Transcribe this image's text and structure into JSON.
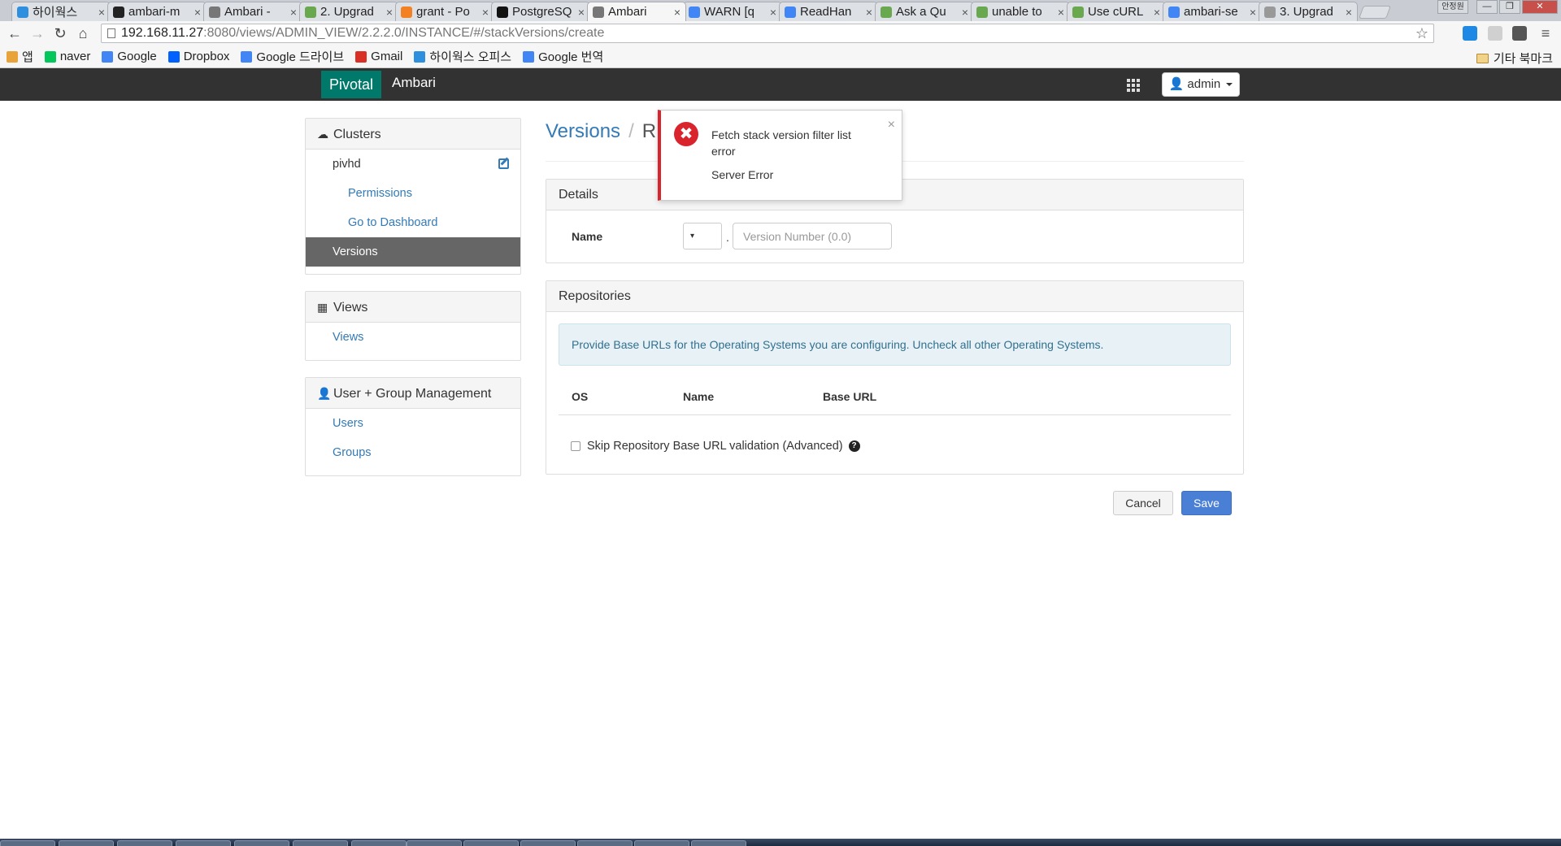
{
  "browser": {
    "tabs": [
      {
        "title": "하이웍스",
        "color": "#2f8fdf",
        "active": false
      },
      {
        "title": "ambari-m",
        "color": "#222222",
        "active": false
      },
      {
        "title": "Ambari -",
        "color": "#777777",
        "active": false
      },
      {
        "title": "2. Upgrad",
        "color": "#6aa84f",
        "active": false
      },
      {
        "title": "grant - Po",
        "color": "#f48024",
        "active": false
      },
      {
        "title": "PostgreSQ",
        "color": "#111111",
        "active": false
      },
      {
        "title": "Ambari",
        "color": "#777777",
        "active": true
      },
      {
        "title": "WARN [q",
        "color": "#4285f4",
        "active": false
      },
      {
        "title": "ReadHan",
        "color": "#4285f4",
        "active": false
      },
      {
        "title": "Ask a Qu",
        "color": "#6aa84f",
        "active": false
      },
      {
        "title": "unable to",
        "color": "#6aa84f",
        "active": false
      },
      {
        "title": "Use cURL",
        "color": "#6aa84f",
        "active": false
      },
      {
        "title": "ambari-se",
        "color": "#4285f4",
        "active": false
      },
      {
        "title": "3. Upgrad",
        "color": "#999999",
        "active": false
      }
    ],
    "window_user": "안정원",
    "url_host": "192.168.11.27",
    "url_rest": ":8080/views/ADMIN_VIEW/2.2.2.0/INSTANCE/#/stackVersions/create",
    "bookmarks": [
      {
        "label": "앱",
        "color": "#e8a33b",
        "icon": "apps-icon"
      },
      {
        "label": "naver",
        "color": "#03c75a",
        "icon": "naver-icon"
      },
      {
        "label": "Google",
        "color": "#4285f4",
        "icon": "google-icon"
      },
      {
        "label": "Dropbox",
        "color": "#0061fe",
        "icon": "dropbox-icon"
      },
      {
        "label": "Google 드라이브",
        "color": "#4285f4",
        "icon": "google-icon"
      },
      {
        "label": "Gmail",
        "color": "#d93025",
        "icon": "gmail-icon"
      },
      {
        "label": "하이웍스 오피스",
        "color": "#2f8fdf",
        "icon": "hiworks-icon"
      },
      {
        "label": "Google 번역",
        "color": "#4285f4",
        "icon": "translate-icon"
      }
    ],
    "other_bookmarks": "기타 북마크"
  },
  "app": {
    "brand_left": "Pivotal",
    "brand_right": "Ambari",
    "user_menu": "admin"
  },
  "sidebar": {
    "clusters_title": "Clusters",
    "cluster_name": "pivhd",
    "permissions": "Permissions",
    "go_to_dashboard": "Go to Dashboard",
    "versions": "Versions",
    "views_title": "Views",
    "views_link": "Views",
    "ugm_title": "User + Group Management",
    "users": "Users",
    "groups": "Groups"
  },
  "main": {
    "breadcrumb_root": "Versions",
    "breadcrumb_sep": "/",
    "breadcrumb_current": "R",
    "details_title": "Details",
    "name_label": "Name",
    "stack_select_value": "▾",
    "name_dot": ".",
    "version_placeholder": "Version Number (0.0)",
    "repos_title": "Repositories",
    "repos_info": "Provide Base URLs for the Operating Systems you are configuring. Uncheck all other Operating Systems.",
    "table_headers": [
      "OS",
      "Name",
      "Base URL"
    ],
    "skip_validation": "Skip Repository Base URL validation (Advanced)",
    "cancel": "Cancel",
    "save": "Save"
  },
  "toast": {
    "title": "Fetch stack version filter list error",
    "message": "Server Error",
    "close": "×"
  },
  "colors": {
    "navbar": "#323232",
    "pivotal_green": "#00796b",
    "link_blue": "#337ab7",
    "active_item": "#666666",
    "save_blue": "#4a7fd6",
    "error_red": "#d9232d"
  }
}
